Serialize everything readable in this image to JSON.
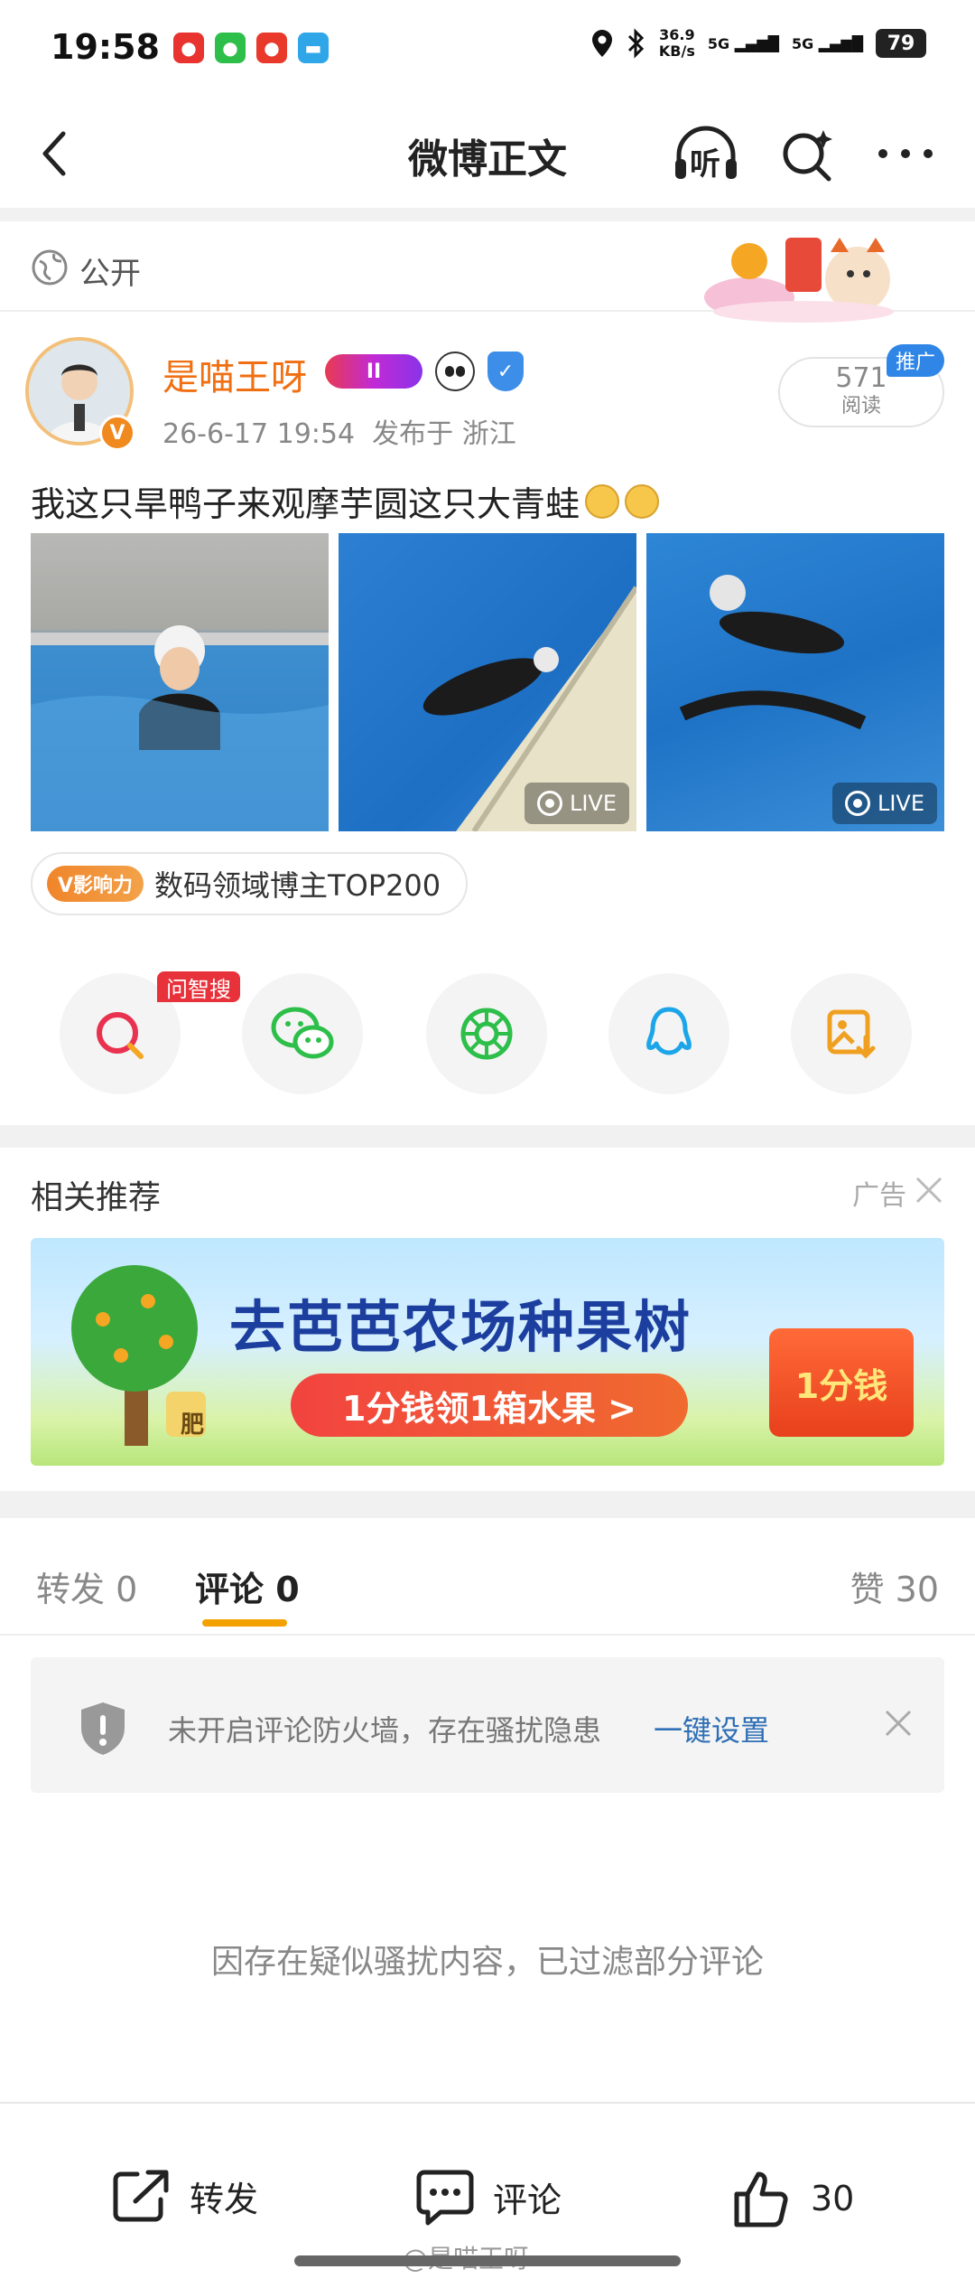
{
  "status_bar": {
    "time": "19:58",
    "net_speed_value": "36.9",
    "net_speed_unit": "KB/s",
    "signal1": "5G",
    "signal2": "5G",
    "battery": "79"
  },
  "nav": {
    "title": "微博正文",
    "listen_label": "听"
  },
  "post": {
    "visibility": "公开",
    "username": "是喵王呀",
    "level_badge": "II",
    "verified_mark": "V",
    "timestamp": "26-6-17 19:54",
    "location": "发布于 浙江",
    "read_count": "571",
    "read_label": "阅读",
    "promo_tag": "推广",
    "text": "我这只旱鸭子来观摩芋圆这只大青蛙",
    "photos": [
      {
        "live": false
      },
      {
        "live": true,
        "live_label": "LIVE"
      },
      {
        "live": true,
        "live_label": "LIVE"
      }
    ],
    "influence_tag": "V影响力",
    "influence_text": "数码领域博主TOP200",
    "search_tag": "问智搜"
  },
  "recommend": {
    "title": "相关推荐",
    "ad_label": "广告",
    "banner_title": "去芭芭农场种果树",
    "banner_button": "1分钱领1箱水果 >",
    "banner_box": "1分钱",
    "banner_tree_tag": "肥"
  },
  "comments": {
    "tabs": [
      {
        "label": "转发 0"
      },
      {
        "label": "评论 0"
      },
      {
        "label": "赞 30"
      }
    ],
    "firewall_text": "未开启评论防火墙，存在骚扰隐患",
    "firewall_link": "一键设置",
    "filtered_text": "因存在疑似骚扰内容，已过滤部分评论"
  },
  "bottom_bar": {
    "repost": "转发",
    "comment": "评论",
    "like_count": "30"
  },
  "watermark": "@是喵王呀",
  "colors": {
    "accent_orange": "#f06f12",
    "link_blue": "#2f6fb5",
    "tab_indicator": "#f3a100"
  }
}
